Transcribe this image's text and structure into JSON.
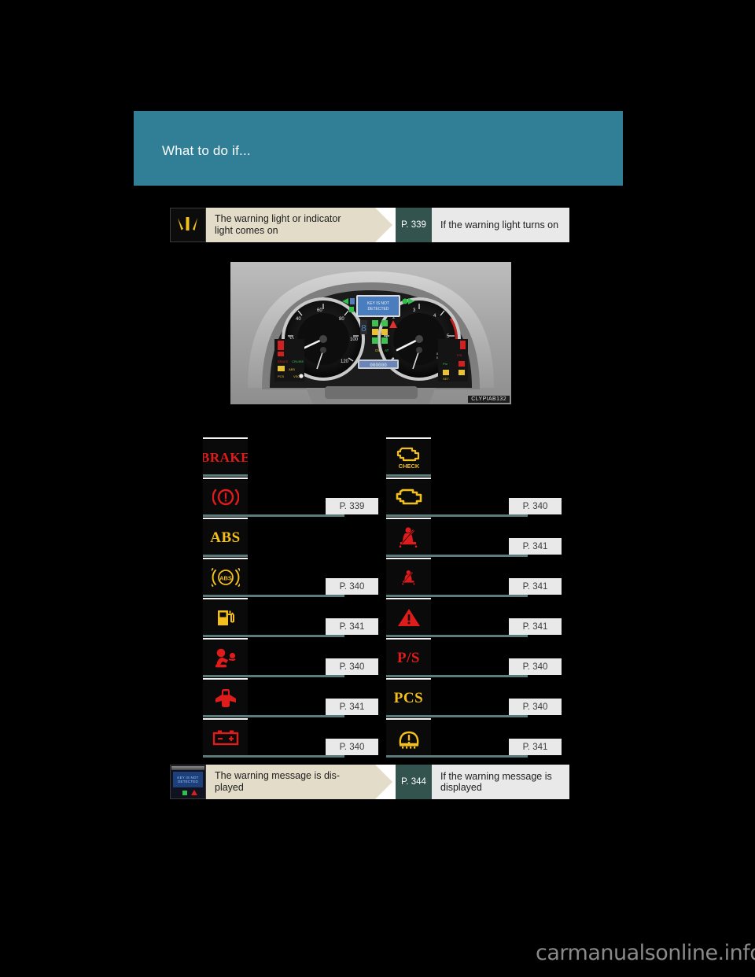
{
  "page": {
    "background_color": "#000000",
    "header": {
      "title": "What to do if...",
      "band_color": "#307f96"
    },
    "watermark": "carmanualsonline.info"
  },
  "top_flow": {
    "icon": "warning-rays-icon",
    "label": "The warning light or indicator light comes on",
    "page_ref": "P. 339",
    "destination": "If the warning light turns on"
  },
  "figure": {
    "caption": "CLYPIAB132",
    "display_line1": "KEY IS NOT",
    "display_line2": "DETECTED"
  },
  "icon_table": {
    "left_column": [
      {
        "icon": "brake-text-icon",
        "label": "BRAKE",
        "page_ref": ""
      },
      {
        "icon": "brake-system-icon",
        "label": "",
        "page_ref": "P. 339"
      },
      {
        "icon": "abs-text-icon",
        "label": "ABS",
        "page_ref": ""
      },
      {
        "icon": "abs-circle-icon",
        "label": "ABS",
        "page_ref": "P. 340"
      },
      {
        "icon": "low-fuel-icon",
        "label": "",
        "page_ref": "P. 341"
      },
      {
        "icon": "srs-airbag-icon",
        "label": "",
        "page_ref": "P. 340"
      },
      {
        "icon": "door-open-icon",
        "label": "",
        "page_ref": "P. 341"
      },
      {
        "icon": "charging-battery-icon",
        "label": "",
        "page_ref": "P. 340"
      }
    ],
    "right_column": [
      {
        "icon": "check-engine-text-icon",
        "label": "CHECK",
        "page_ref": ""
      },
      {
        "icon": "check-engine-icon",
        "label": "",
        "page_ref": "P. 340"
      },
      {
        "icon": "driver-seatbelt-icon",
        "label": "",
        "page_ref": "P. 341"
      },
      {
        "icon": "rear-seatbelt-icon",
        "label": "",
        "page_ref": "P. 341"
      },
      {
        "icon": "master-warning-icon",
        "label": "",
        "page_ref": "P. 341"
      },
      {
        "icon": "power-steering-icon",
        "label": "P/S",
        "page_ref": "P. 340"
      },
      {
        "icon": "pre-collision-icon",
        "label": "PCS",
        "page_ref": "P. 340"
      },
      {
        "icon": "tire-pressure-icon",
        "label": "",
        "page_ref": "P. 341"
      }
    ]
  },
  "bottom_flow": {
    "icon": "multi-info-display-icon",
    "label": "The warning message is dis-played",
    "page_ref": "P. 344",
    "destination": "If the warning message is displayed"
  },
  "colors": {
    "teal_band": "#307f96",
    "beige_callout": "#e3dcc9",
    "dark_teal_badge": "#33534f",
    "light_gray_panel": "#e9e9e9",
    "rule_teal": "#5c7b7b",
    "warning_red": "#e01b1b",
    "warning_amber": "#f2bf1d"
  }
}
